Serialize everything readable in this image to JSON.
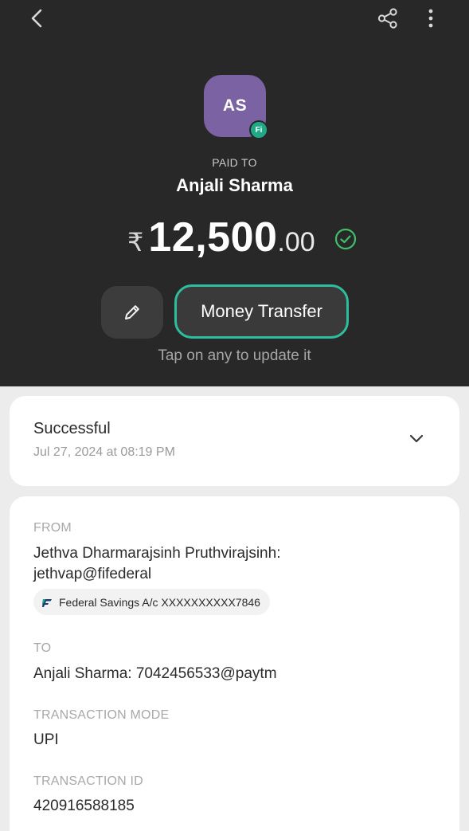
{
  "colors": {
    "header_bg": "#282828",
    "avatar_bg": "#7a62a3",
    "accent": "#2dbd9f",
    "success": "#3fbf6a"
  },
  "header": {
    "back_icon": "chevron-left-icon",
    "share_icon": "share-icon",
    "more_icon": "more-vertical-icon"
  },
  "payee": {
    "initials": "AS",
    "badge": "Fi",
    "paid_to_label": "PAID TO",
    "name": "Anjali Sharma"
  },
  "amount": {
    "currency": "₹",
    "main": "12,500",
    "decimal": ".00",
    "status_icon": "check-circle-icon"
  },
  "actions": {
    "edit_icon": "pencil-icon",
    "category_label": "Money Transfer",
    "hint": "Tap on any to update it"
  },
  "status": {
    "title": "Successful",
    "timestamp": "Jul 27, 2024 at 08:19 PM",
    "expand_icon": "chevron-down-icon"
  },
  "details": {
    "from_label": "FROM",
    "from_line1": "Jethva Dharmarajsinh Pruthvirajsinh:",
    "from_line2": "jethvap@fifederal",
    "account": "Federal Savings A/c XXXXXXXXXX7846",
    "to_label": "TO",
    "to_value": "Anjali Sharma: 7042456533@paytm",
    "mode_label": "TRANSACTION MODE",
    "mode_value": "UPI",
    "txn_label": "TRANSACTION ID",
    "txn_value": "420916588185"
  }
}
